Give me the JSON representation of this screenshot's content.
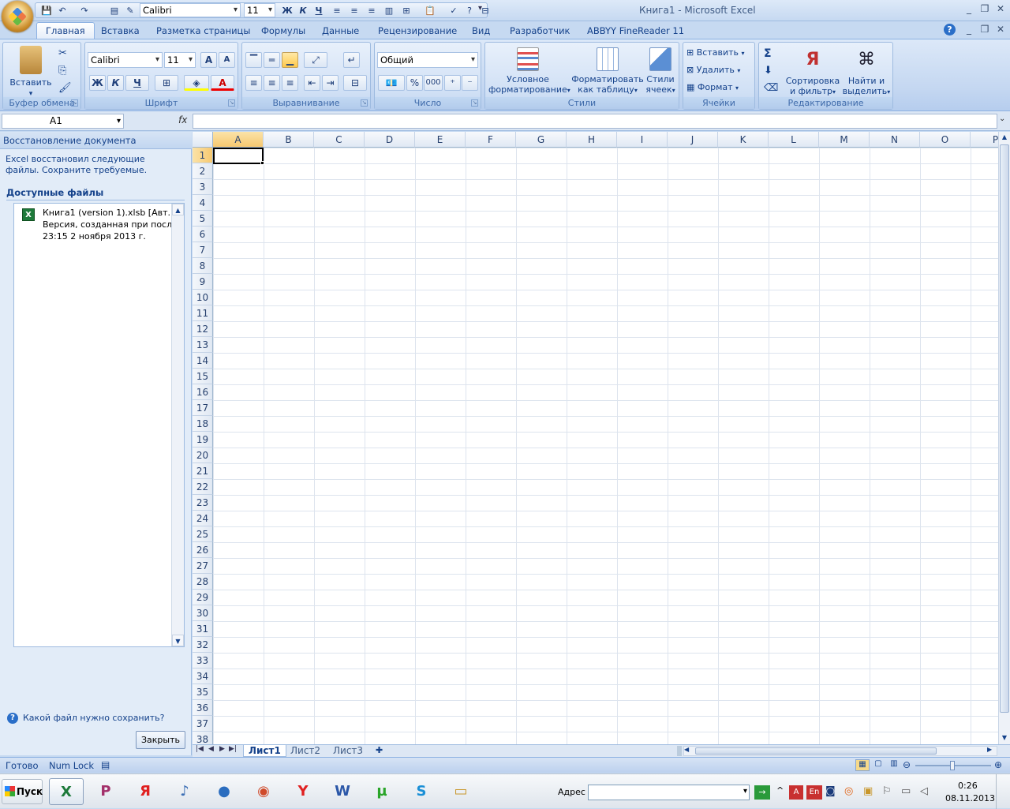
{
  "window": {
    "title": "Книга1 - Microsoft Excel"
  },
  "qat": {
    "font": "Calibri",
    "size": "11",
    "bold": "Ж",
    "italic": "К",
    "underline": "Ч"
  },
  "tabs": [
    "Главная",
    "Вставка",
    "Разметка страницы",
    "Формулы",
    "Данные",
    "Рецензирование",
    "Вид",
    "Разработчик",
    "ABBYY FineReader 11"
  ],
  "ribbon": {
    "clipboard": {
      "label": "Буфер обмена",
      "paste": "Вставить"
    },
    "font": {
      "label": "Шрифт",
      "name": "Calibri",
      "size": "11",
      "bold": "Ж",
      "italic": "К",
      "underline": "Ч",
      "grow": "A",
      "shrink": "A"
    },
    "align": {
      "label": "Выравнивание"
    },
    "number": {
      "label": "Число",
      "format": "Общий",
      "percent": "%",
      "thousands": "000"
    },
    "styles": {
      "label": "Стили",
      "cond1": "Условное",
      "cond2": "форматирование",
      "table1": "Форматировать",
      "table2": "как таблицу",
      "cell1": "Стили",
      "cell2": "ячеек"
    },
    "cells": {
      "label": "Ячейки",
      "insert": "Вставить",
      "delete": "Удалить",
      "format": "Формат"
    },
    "editing": {
      "label": "Редактирование",
      "sum": "Σ",
      "sort1": "Сортировка",
      "sort2": "и фильтр",
      "find1": "Найти и",
      "find2": "выделить"
    }
  },
  "formula": {
    "namebox": "A1",
    "fx": "fx",
    "value": ""
  },
  "recovery": {
    "title": "Восстановление документа",
    "message": "Excel восстановил следующие файлы. Сохраните требуемые.",
    "available": "Доступные файлы",
    "file": {
      "name": "Книга1 (version 1).xlsb  [Авт...",
      "desc": "Версия, созданная при посл...",
      "date": "23:15 2 ноября 2013 г."
    },
    "help": "Какой файл нужно сохранить?",
    "close": "Закрыть"
  },
  "columns": [
    "A",
    "B",
    "C",
    "D",
    "E",
    "F",
    "G",
    "H",
    "I",
    "J",
    "K",
    "L",
    "M",
    "N",
    "O",
    "P"
  ],
  "rows": [
    "1",
    "2",
    "3",
    "4",
    "5",
    "6",
    "7",
    "8",
    "9",
    "10",
    "11",
    "12",
    "13",
    "14",
    "15",
    "16",
    "17",
    "18",
    "19",
    "20",
    "21",
    "22",
    "23",
    "24",
    "25",
    "26",
    "27",
    "28",
    "29",
    "30",
    "31",
    "32",
    "33",
    "34",
    "35",
    "36",
    "37",
    "38"
  ],
  "sheets": [
    "Лист1",
    "Лист2",
    "Лист3"
  ],
  "status": {
    "ready": "Готово",
    "numlock": "Num Lock"
  },
  "taskbar": {
    "start": "Пуск",
    "address": "Адрес",
    "time": "0:26",
    "date": "08.11.2013",
    "lang": "En"
  }
}
